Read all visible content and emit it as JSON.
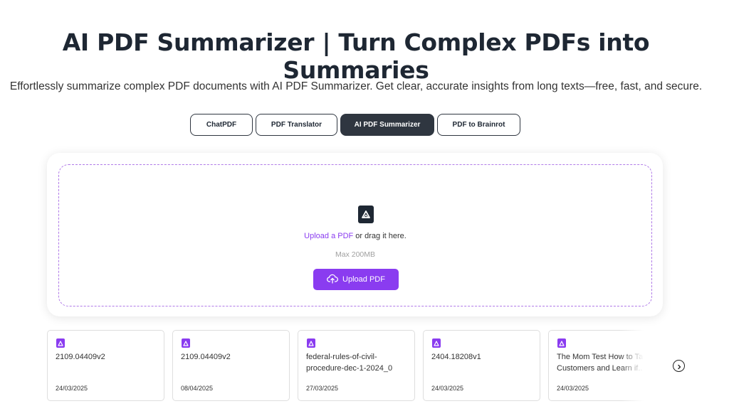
{
  "header": {
    "title": "AI PDF Summarizer | Turn Complex PDFs into Summaries",
    "subtitle": "Effortlessly summarize complex PDF documents with AI PDF Summarizer. Get clear, accurate insights from long texts—free, fast, and secure."
  },
  "tabs": [
    {
      "label": "ChatPDF",
      "active": false
    },
    {
      "label": "PDF Translator",
      "active": false
    },
    {
      "label": "AI PDF Summarizer",
      "active": true
    },
    {
      "label": "PDF to Brainrot",
      "active": false
    }
  ],
  "upload": {
    "pdf_icon": "pdf-file-icon",
    "link_label": "Upload a PDF",
    "drag_text": " or drag it here.",
    "max_size": "Max 200MB",
    "button_label": "Upload PDF",
    "button_icon": "cloud-upload-icon"
  },
  "recent_files": [
    {
      "name": "2109.04409v2",
      "date": "24/03/2025"
    },
    {
      "name": "2109.04409v2",
      "date": "08/04/2025"
    },
    {
      "name": "federal-rules-of-civil-procedure-dec-1-2024_0",
      "date": "27/03/2025"
    },
    {
      "name": "2404.18208v1",
      "date": "24/03/2025"
    },
    {
      "name": "The Mom Test How to Talk to Customers and Learn if...",
      "date": "24/03/2025"
    }
  ],
  "colors": {
    "accent": "#8a3cf0",
    "dark": "#2f3640",
    "title": "#1e2733"
  }
}
